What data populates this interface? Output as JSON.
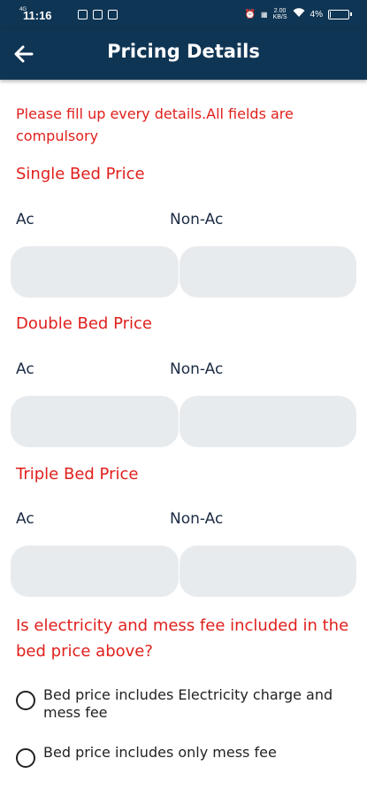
{
  "status_bar": {
    "time": "11:16",
    "network": "4G",
    "battery": "4%",
    "battery_level": 0.04,
    "speed": "2.00",
    "speed_unit": "KB/S"
  },
  "header": {
    "title": "Pricing Details",
    "background_color": "#0f3554"
  },
  "notice": "Please fill up every details.All fields are compulsory",
  "sections": [
    {
      "title": "Single Bed Price",
      "ac_label": "Ac",
      "nonac_label": "Non-Ac",
      "ac_value": "",
      "nonac_value": ""
    },
    {
      "title": "Double Bed Price",
      "ac_label": "Ac",
      "nonac_label": "Non-Ac",
      "ac_value": "",
      "nonac_value": ""
    },
    {
      "title": "Triple Bed Price",
      "ac_label": "Ac",
      "nonac_label": "Non-Ac",
      "ac_value": "",
      "nonac_value": ""
    }
  ],
  "question": "Is electricity and mess fee included in the bed price above?",
  "options": [
    {
      "label": "Bed price includes Electricity charge and mess fee",
      "selected": false
    },
    {
      "label": "Bed price includes only  mess fee",
      "selected": false
    }
  ],
  "colors": {
    "accent_red": "#e0201d",
    "field_bg": "#e8ebee",
    "label_text": "#1b2b44"
  }
}
